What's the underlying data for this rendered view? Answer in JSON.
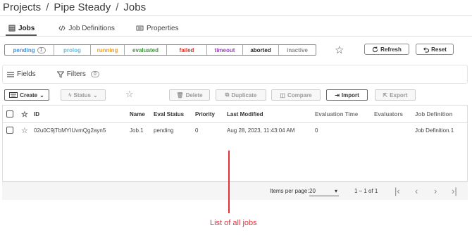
{
  "breadcrumb": {
    "root": "Projects",
    "project": "Pipe Steady",
    "current": "Jobs"
  },
  "tabs": [
    {
      "label": "Jobs",
      "icon": "grid-icon"
    },
    {
      "label": "Job Definitions",
      "icon": "code-icon"
    },
    {
      "label": "Properties",
      "icon": "card-icon"
    }
  ],
  "statuses": [
    {
      "label": "pending",
      "count": "1",
      "color": "#4a90d9"
    },
    {
      "label": "prolog",
      "color": "#5bc0de"
    },
    {
      "label": "running",
      "color": "#f0a030"
    },
    {
      "label": "evaluated",
      "color": "#3c9a3c"
    },
    {
      "label": "failed",
      "color": "#d9342b"
    },
    {
      "label": "timeout",
      "color": "#9b3fbf"
    },
    {
      "label": "aborted",
      "color": "#222222"
    },
    {
      "label": "inactive",
      "color": "#888888"
    }
  ],
  "actions": {
    "refresh": "Refresh",
    "reset": "Reset"
  },
  "panel": {
    "fields": "Fields",
    "filters": "Filters",
    "filters_count": "0"
  },
  "toolbar": {
    "create": "Create",
    "status": "Status",
    "delete": "Delete",
    "duplicate": "Duplicate",
    "compare": "Compare",
    "import": "Import",
    "export": "Export"
  },
  "table": {
    "columns": [
      "ID",
      "Name",
      "Eval Status",
      "Priority",
      "Last Modified",
      "Evaluation Time",
      "Evaluators",
      "Job Definition"
    ],
    "rows": [
      {
        "id": "02u0C9jTbMYIUvmQg2ayn5",
        "name": "Job.1",
        "eval_status": "pending",
        "priority": "0",
        "last_modified": "Aug 28, 2023, 11:43:04 AM",
        "evaluation_time": "0",
        "evaluators": "",
        "job_definition": "Job Definition.1"
      }
    ]
  },
  "footer": {
    "items_per_page_label": "Items per page:",
    "items_per_page": "20",
    "range": "1 – 1 of 1"
  },
  "annotation": {
    "caption": "List of all jobs",
    "color": "#e0303a"
  }
}
